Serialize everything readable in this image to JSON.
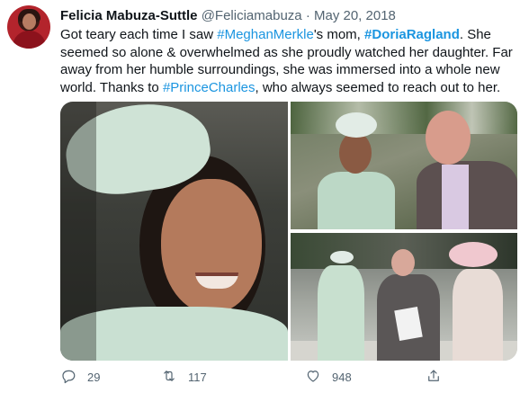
{
  "tweet": {
    "author_name": "Felicia Mabuza-Suttle",
    "handle": "@Feliciamabuza",
    "separator": "·",
    "date": "May 20, 2018",
    "text": {
      "p1": "Got teary each time I saw ",
      "tag1": "#MeghanMerkle",
      "p2": "'s mom, ",
      "tag2": "#DoriaRagland",
      "p3": ". She seemed so alone & overwhelmed as she proudly watched her daughter. Far away from her humble surroundings, she was immersed into a whole new world. Thanks to ",
      "tag3": "#PrinceCharles",
      "p4": ", who always seemed to reach out to her."
    },
    "media": {
      "images": [
        "photo-1",
        "photo-2",
        "photo-3"
      ]
    },
    "actions": {
      "reply": {
        "icon": "reply-icon",
        "count": "29"
      },
      "retweet": {
        "icon": "retweet-icon",
        "count": "117"
      },
      "like": {
        "icon": "heart-icon",
        "count": "948"
      },
      "share": {
        "icon": "share-icon",
        "count": ""
      }
    }
  },
  "colors": {
    "link": "#1b95e0",
    "text": "#0f1419",
    "muted": "#536471"
  }
}
